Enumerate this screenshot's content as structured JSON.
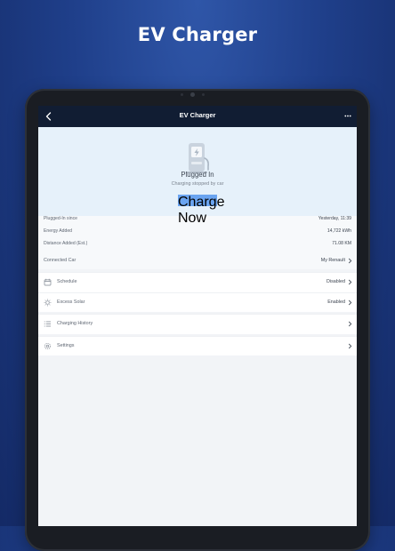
{
  "promo": {
    "title": "EV Charger"
  },
  "appbar": {
    "title": "EV Charger"
  },
  "hero": {
    "status": "Plugged In",
    "substatus": "Charging stopped by car",
    "button": "Charge Now"
  },
  "details": [
    {
      "label": "Plugged-In since",
      "value": "Yesterday, 11:39"
    },
    {
      "label": "Energy Added",
      "value": "14,722 kWh"
    },
    {
      "label": "Distance Added (Est.)",
      "value": "71.08 KM"
    }
  ],
  "car": {
    "label": "Connected Car",
    "value": "My Renault"
  },
  "menu": [
    {
      "label": "Schedule",
      "value": "Disabled",
      "icon": "calendar-icon"
    },
    {
      "label": "Excess Solar",
      "value": "Enabled",
      "icon": "sun-icon"
    },
    {
      "label": "Charging History",
      "value": "",
      "icon": "list-icon"
    },
    {
      "label": "Settings",
      "value": "",
      "icon": "gear-icon"
    }
  ],
  "colors": {
    "accent": "#6aa4f0",
    "appbar": "#111d33",
    "hero": "#e6f1fa"
  }
}
